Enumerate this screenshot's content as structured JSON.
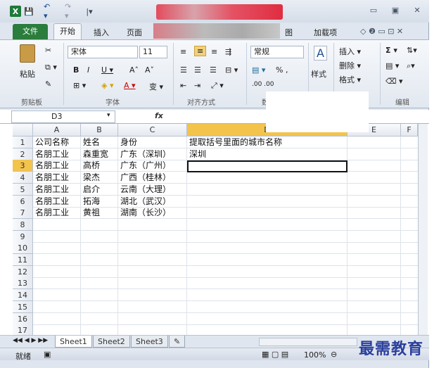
{
  "qat": {
    "app_icon": "X",
    "save": "💾",
    "undo": "↶ ▾",
    "redo": "↷ ▾",
    "more": "|▾"
  },
  "window_controls": {
    "minimize": "▭",
    "restore": "▣",
    "close": "✕"
  },
  "tabs": {
    "file": "文件",
    "home": "开始",
    "insert": "插入",
    "page_partial": "页面",
    "view_partial": "图",
    "addins": "加载项"
  },
  "ribbon_controls": {
    "help": "◇ ❷ ▭ ⊡ ✕"
  },
  "clipboard": {
    "paste": "粘贴",
    "label": "剪贴板"
  },
  "font": {
    "name": "宋体",
    "size": "11",
    "bold": "B",
    "italic": "I",
    "underline": "U ▾",
    "grow": "A˄",
    "shrink": "A˅",
    "phonetic": "变 ▾",
    "label": "字体"
  },
  "alignment": {
    "label": "对齐方式"
  },
  "number": {
    "format": "常规",
    "label": "数",
    "percent": "% ,",
    "dec": ".00 .00"
  },
  "styles": {
    "label": "样式"
  },
  "cells": {
    "insert": "插入 ▾",
    "delete": "删除 ▾",
    "format": "格式 ▾"
  },
  "editing": {
    "sum": "Σ ▾",
    "sort": "排序",
    "label": "编辑"
  },
  "namebox": {
    "value": "D3"
  },
  "formula": {
    "fx": "fx"
  },
  "columns": [
    "A",
    "B",
    "C",
    "D",
    "E",
    "F"
  ],
  "rows": [
    "1",
    "2",
    "3",
    "4",
    "5",
    "6",
    "7",
    "8",
    "9",
    "10",
    "11",
    "12",
    "13",
    "14",
    "15",
    "16",
    "17"
  ],
  "cells_data": {
    "A": [
      "公司名称",
      "名朋工业",
      "名朋工业",
      "名朋工业",
      "名朋工业",
      "名朋工业",
      "名朋工业"
    ],
    "B": [
      "姓名",
      "森重宽",
      "高桥",
      "梁杰",
      "启介",
      "拓海",
      "黄祖"
    ],
    "C": [
      "身份",
      "广东（深圳）",
      "广东（广州）",
      "广西（桂林）",
      "云南（大理）",
      "湖北（武汉）",
      "湖南（长沙）"
    ],
    "D": [
      "提取括号里面的城市名称",
      "深圳"
    ]
  },
  "sheet_tabs": [
    "Sheet1",
    "Sheet2",
    "Sheet3"
  ],
  "status": {
    "ready": "就绪",
    "zoom": "100%"
  },
  "watermark": "最需教育"
}
